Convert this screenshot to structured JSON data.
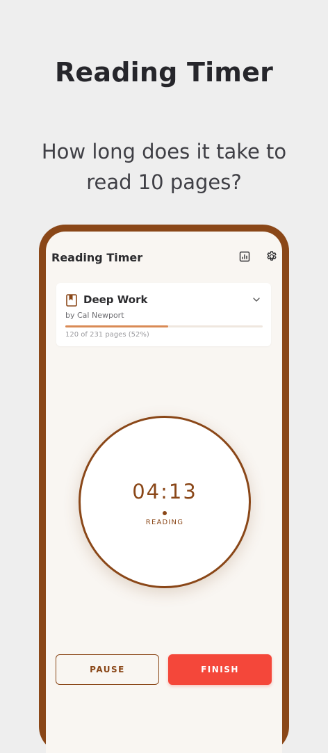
{
  "promo": {
    "title": "Reading Timer",
    "subtitle": "How long does it take to read 10 pages?"
  },
  "app": {
    "title": "Reading Timer",
    "icons": {
      "stats": "bar-chart-icon",
      "settings": "gear-icon"
    }
  },
  "book": {
    "title": "Deep Work",
    "author": "by Cal Newport",
    "progress_text": "120 of 231 pages (52%)",
    "progress_fraction": 0.52
  },
  "timer": {
    "time": "04:13",
    "state": "READING"
  },
  "actions": {
    "pause_label": "PAUSE",
    "finish_label": "FINISH"
  },
  "colors": {
    "accent": "#8a4718",
    "finish": "#f4473a",
    "progress": "#d98a55",
    "background": "#eeeeee",
    "screen": "#f9f6f2"
  }
}
